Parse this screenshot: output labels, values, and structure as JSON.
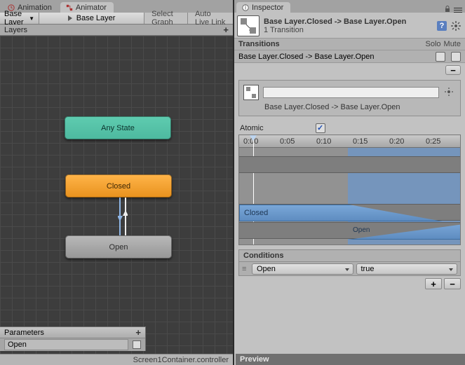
{
  "tabs": {
    "animation": "Animation",
    "animator": "Animator",
    "inspector": "Inspector"
  },
  "subbar": {
    "base_layer": "Base Layer",
    "layer_path": "Base Layer",
    "select_graph": "Select Graph",
    "auto_live": "Auto Live Link"
  },
  "layers_header": "Layers",
  "graph": {
    "any_state": "Any State",
    "closed": "Closed",
    "open": "Open"
  },
  "parameters": {
    "header": "Parameters",
    "items": [
      {
        "name": "Open",
        "checked": false
      }
    ]
  },
  "status_bar": "Screen1Container.controller",
  "inspector": {
    "title": "Base Layer.Closed -> Base Layer.Open",
    "subtitle": "1 Transition",
    "transitions_header": "Transitions",
    "solo_label": "Solo",
    "mute_label": "Mute",
    "transition_row": "Base Layer.Closed -> Base Layer.Open",
    "detail_label": "Base Layer.Closed -> Base Layer.Open",
    "atomic_label": "Atomic",
    "atomic_checked": true,
    "timeline": {
      "labels": [
        "0:00",
        "0:05",
        "0:10",
        "0:15",
        "0:20",
        "0:25"
      ],
      "closed_bar": "Closed",
      "open_bar": "Open"
    },
    "conditions": {
      "header": "Conditions",
      "rows": [
        {
          "param": "Open",
          "value": "true"
        }
      ]
    }
  },
  "preview": "Preview"
}
